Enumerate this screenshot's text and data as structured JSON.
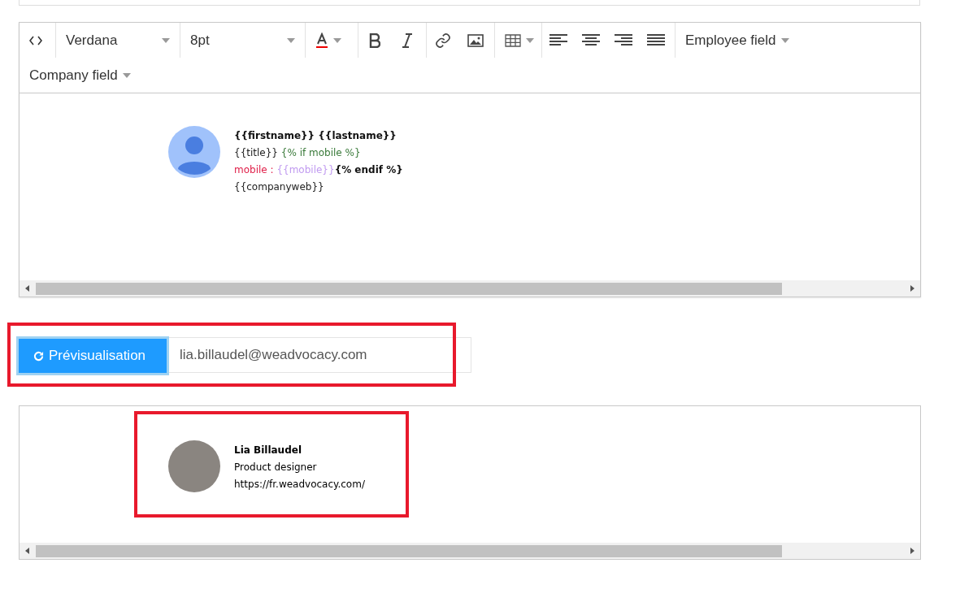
{
  "editor": {
    "toolbar": {
      "font": "Verdana",
      "size": "8pt",
      "field_menus": [
        "Employee field",
        "Company field"
      ]
    },
    "template_lines": [
      [
        {
          "kind": "bold",
          "text": "{{firstname}} {{lastname}}"
        }
      ],
      [
        {
          "kind": "plain",
          "text": "{{title}} "
        },
        {
          "kind": "logic",
          "text": "{% if mobile %}"
        }
      ],
      [
        {
          "kind": "label",
          "text": "mobile : "
        },
        {
          "kind": "variable",
          "text": "{{mobile}}"
        },
        {
          "kind": "bold",
          "text": "{% endif %}"
        }
      ],
      [
        {
          "kind": "plain",
          "text": "{{companyweb}}"
        }
      ]
    ]
  },
  "preview_bar": {
    "button": "Prévisualisation",
    "email": "lia.billaudel@weadvocacy.com"
  },
  "preview": {
    "name": "Lia Billaudel",
    "title": "Product designer",
    "url": "https://fr.weadvocacy.com/"
  }
}
